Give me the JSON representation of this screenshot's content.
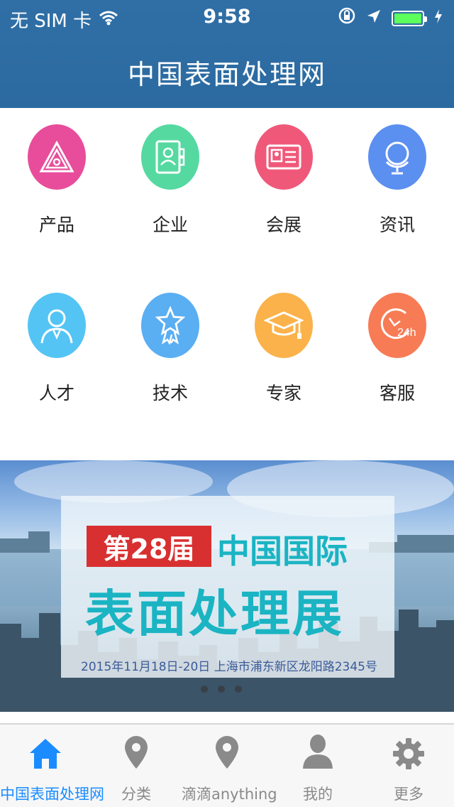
{
  "status": {
    "carrier": "无 SIM 卡",
    "time": "9:58"
  },
  "header": {
    "title": "中国表面处理网"
  },
  "grid": {
    "items": [
      {
        "label": "产品",
        "icon": "triangle-logo-icon",
        "color": "#e84d9b"
      },
      {
        "label": "企业",
        "icon": "company-card-icon",
        "color": "#55d9a0"
      },
      {
        "label": "会展",
        "icon": "id-card-icon",
        "color": "#f0587a"
      },
      {
        "label": "资讯",
        "icon": "globe-icon",
        "color": "#5b8ff0"
      },
      {
        "label": "人才",
        "icon": "person-icon",
        "color": "#54c4f4"
      },
      {
        "label": "技术",
        "icon": "star-award-icon",
        "color": "#5aaef2"
      },
      {
        "label": "专家",
        "icon": "graduation-cap-icon",
        "color": "#fbb24a"
      },
      {
        "label": "客服",
        "icon": "clock-24h-icon",
        "color": "#f77b55"
      }
    ]
  },
  "banner": {
    "badge": "第28届",
    "line1": "中国国际",
    "line2": "表面处理展",
    "info": "2015年11月18日-20日 上海市浦东新区龙阳路2345号"
  },
  "tabbar": {
    "items": [
      {
        "label": "中国表面处理网",
        "icon": "home-icon",
        "active": true
      },
      {
        "label": "分类",
        "icon": "location-pin-icon",
        "active": false
      },
      {
        "label": "滴滴anything",
        "icon": "location-pin-icon",
        "active": false
      },
      {
        "label": "我的",
        "icon": "user-icon",
        "active": false
      },
      {
        "label": "更多",
        "icon": "gear-icon",
        "active": false
      }
    ]
  },
  "colors": {
    "header": "#2e6da3",
    "accent": "#1a8cff",
    "banner_text": "#1ab4c3",
    "badge": "#d83030"
  }
}
